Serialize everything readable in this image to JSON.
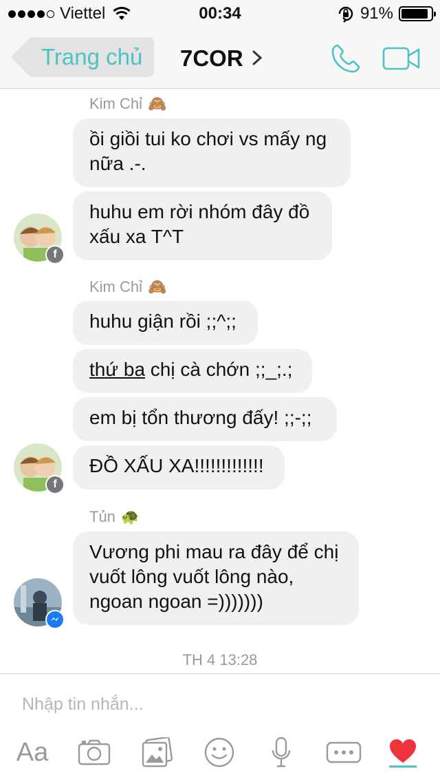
{
  "status_bar": {
    "carrier": "Viettel",
    "time": "00:34",
    "battery_percent": "91%",
    "battery_level": 0.91,
    "signal_bars": 4,
    "signal_max": 5
  },
  "nav": {
    "back_label": "Trang chủ",
    "title": "7COR",
    "accent_color": "#4cc2c3"
  },
  "messages": {
    "group1": {
      "sender": "Kim Chỉ",
      "emoji": "🙈",
      "bubble1": "ồi giồi tui ko chơi vs mấy ng",
      "bubble1_l2": "nữa .-.",
      "bubble2": "huhu em rời nhóm đây đồ",
      "bubble2_l2": "xấu xa T^T"
    },
    "group2": {
      "sender": "Kim Chỉ",
      "emoji": "🙈",
      "bubble1": "huhu giận rồi ;;^;;",
      "bubble2_link": "thứ ba",
      "bubble2_rest": " chị cà chớn ;;_;.;",
      "bubble3": "em bị tổn thương đấy! ;;-;;",
      "bubble4": "ĐỒ XẤU XA!!!!!!!!!!!!!"
    },
    "group3": {
      "sender": "Tủn",
      "emoji": "🐢",
      "bubble1_l1": "Vương phi mau ra đây để chị",
      "bubble1_l2": "vuốt lông vuốt lông nào,",
      "bubble1_l3": "ngoan ngoan =)))))))"
    },
    "timestamp": "TH 4 13:28"
  },
  "composer": {
    "placeholder": "Nhập tin nhắn...",
    "aa_label": "Aa",
    "icons": [
      "text-format-icon",
      "camera-icon",
      "gallery-icon",
      "emoji-icon",
      "microphone-icon",
      "more-icon",
      "heart-icon"
    ],
    "heart_color": "#f0323c"
  }
}
